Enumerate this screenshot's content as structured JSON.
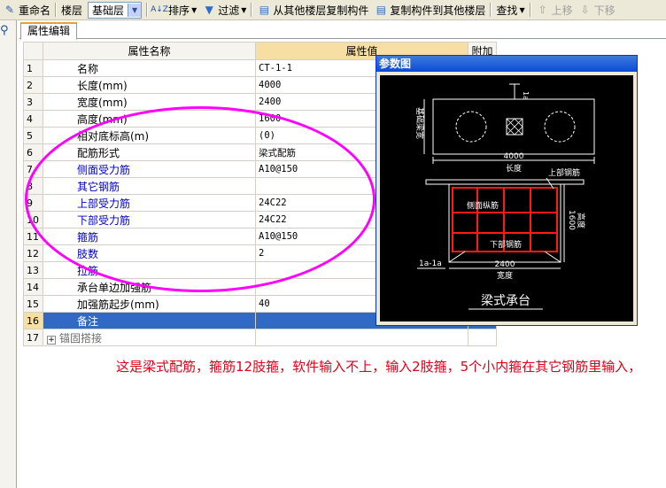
{
  "toolbar": {
    "rename": "重命名",
    "floor_label": "楼层",
    "floor_value": "基础层",
    "sort": "排序",
    "filter": "过滤",
    "copy_from": "从其他楼层复制构件",
    "copy_to": "复制构件到其他楼层",
    "find": "查找",
    "move_up": "上移",
    "move_down": "下移"
  },
  "tab": {
    "label": "属性编辑"
  },
  "grid": {
    "headers": {
      "name": "属性名称",
      "value": "属性值",
      "extra": "附加"
    },
    "rows": [
      {
        "num": "1",
        "name": "名称",
        "value": "CT-1-1"
      },
      {
        "num": "2",
        "name": "长度(mm)",
        "value": "4000"
      },
      {
        "num": "3",
        "name": "宽度(mm)",
        "value": "2400"
      },
      {
        "num": "4",
        "name": "高度(mm)",
        "value": "1600"
      },
      {
        "num": "5",
        "name": "相对底标高(m)",
        "value": "(0)"
      },
      {
        "num": "6",
        "name": "配筋形式",
        "value": "梁式配筋"
      },
      {
        "num": "7",
        "name": "侧面受力筋",
        "value": "A10@150"
      },
      {
        "num": "8",
        "name": "其它钢筋",
        "value": ""
      },
      {
        "num": "9",
        "name": "上部受力筋",
        "value": "24C22"
      },
      {
        "num": "10",
        "name": "下部受力筋",
        "value": "24C22"
      },
      {
        "num": "11",
        "name": "箍筋",
        "value": "A10@150"
      },
      {
        "num": "12",
        "name": "肢数",
        "value": "2"
      },
      {
        "num": "13",
        "name": "拉筋",
        "value": ""
      },
      {
        "num": "14",
        "name": "承台单边加强筋",
        "value": ""
      },
      {
        "num": "15",
        "name": "加强筋起步(mm)",
        "value": "40"
      },
      {
        "num": "16",
        "name": "备注",
        "value": ""
      },
      {
        "num": "17",
        "name": "锚固搭接",
        "value": ""
      }
    ]
  },
  "dialog": {
    "title": "参数图",
    "drawing": {
      "dim_1a": "1a",
      "side_label": "基础梁宽",
      "length_value": "4000",
      "length_label": "长度",
      "top_rebar": "上部钢筋",
      "side_rebar": "侧面纵筋",
      "height_value": "1600",
      "height_label": "高度",
      "bottom_rebar": "下部钢筋",
      "width_value": "2400",
      "width_label": "宽度",
      "section": "1a-1a",
      "caption": "梁式承台"
    }
  },
  "note": "这是梁式配筋，箍筋12肢箍，软件输入不上，输入2肢箍，5个小内箍在其它钢筋里输入，",
  "colors": {
    "annotation_ellipse": "#ff00ff",
    "note_text": "#e0001a",
    "selected_row": "#316ac5",
    "blue_label": "#0000c8"
  }
}
